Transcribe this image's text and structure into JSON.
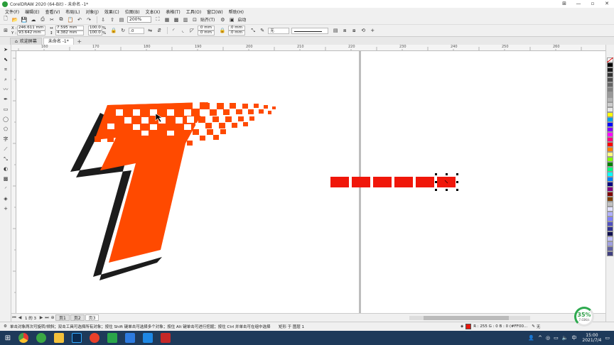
{
  "window": {
    "title": "CorelDRAW 2020 (64-Bit) - 未命名 -1*",
    "controls": [
      "⊞",
      "—",
      "▫",
      "✕"
    ]
  },
  "menu": [
    "文件(F)",
    "编辑(E)",
    "查看(V)",
    "布局(L)",
    "对象(J)",
    "效果(C)",
    "位图(B)",
    "文本(X)",
    "表格(T)",
    "工具(O)",
    "窗口(W)",
    "帮助(H)"
  ],
  "toolbar": {
    "zoom": "200%",
    "snap_label": "贴齐(T)",
    "launch_label": "启动"
  },
  "props": {
    "x_label": "X :",
    "x_value": "246.611 mm",
    "y_label": "Y :",
    "y_value": "93.642 mm",
    "w_value": "7.595 mm",
    "h_value": "4.382 mm",
    "scale_w": "100.0",
    "scale_h": "100.0",
    "pct": "%",
    "angle": ".0",
    "corner1": ".0 mm",
    "corner2": ".0 mm",
    "corner3": ".0 mm",
    "corner4": ".0 mm",
    "outline": "无"
  },
  "tabs": [
    {
      "label": "欢迎屏幕",
      "active": false
    },
    {
      "label": "未命名 -1*",
      "active": true
    }
  ],
  "ruler_numbers": [
    "160",
    "170",
    "180",
    "190",
    "200",
    "210",
    "220",
    "230",
    "240",
    "250",
    "260"
  ],
  "pages": {
    "nav": [
      "⏮",
      "◀",
      "1 的 3",
      "▶",
      "⏭",
      "⊕"
    ],
    "tabs": [
      {
        "label": "页1",
        "active": false
      },
      {
        "label": "页2",
        "active": false
      },
      {
        "label": "页3",
        "active": true
      }
    ]
  },
  "status": {
    "hint": "单击对象两次可旋转/倾斜；双击工具可选择所有对象；按住 Shift 键单击可选择多个对象；按住 Alt 键单击可进行挖掘；按住 Ctrl 并单击可在组中选择",
    "layer": "矩形 于 图层 1",
    "fill": "R : 255 G : 0 B : 0 (#FF00...",
    "outline": "无"
  },
  "progress": {
    "percent": "35%",
    "speed": "7.03K/s",
    "value": 0.35
  },
  "taskbar": {
    "time": "15:00",
    "date": "2021/7/4"
  },
  "colors": {
    "logo_orange": "#ff4a00",
    "logo_dark": "#1c1c1c",
    "rect_red": "#f0170a",
    "selection": "#000000",
    "palette": [
      "#ffffff",
      "#000000",
      "#1a1a1a",
      "#333333",
      "#4d4d4d",
      "#666666",
      "#808080",
      "#999999",
      "#b3b3b3",
      "#cccccc",
      "#e6e6e6",
      "#ffff00",
      "#00a0e9",
      "#0000ff",
      "#8000ff",
      "#ff00ff",
      "#ff0080",
      "#ff0000",
      "#ff8000",
      "#ffff80",
      "#80ff00",
      "#008000",
      "#00ff80",
      "#00ffff",
      "#0080ff",
      "#000080",
      "#800080",
      "#800000",
      "#804000",
      "#c0c0c0",
      "#e0e0ff",
      "#b0b0ff",
      "#8080ff",
      "#5050c0",
      "#303090",
      "#101050",
      "#c0c0ff",
      "#a0a0e0",
      "#6060a0",
      "#404080"
    ]
  }
}
